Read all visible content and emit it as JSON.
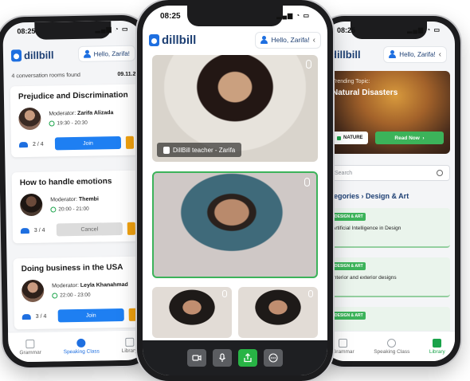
{
  "status": {
    "time": "08:25"
  },
  "brand": {
    "logo_text": "dillbill"
  },
  "header": {
    "greeting": "Hello, Zarifa!"
  },
  "left_phone": {
    "found_text": "4 conversation rooms found",
    "date": "09.11.2",
    "rooms": [
      {
        "title": "Prejudice and Discrimination",
        "moderator_label": "Moderator:",
        "moderator": "Zarifa Alizada",
        "time": "19:30 - 20:30",
        "count": "2 / 4",
        "action": "Join"
      },
      {
        "title": "How to handle emotions",
        "moderator_label": "Moderator:",
        "moderator": "Thembi",
        "time": "20:00 - 21:00",
        "count": "3 / 4",
        "action": "Cancel"
      },
      {
        "title": "Doing business in the USA",
        "moderator_label": "Moderator:",
        "moderator": "Leyla Khanahmad",
        "time": "22:00 - 23:00",
        "count": "3 / 4",
        "action": "Join"
      }
    ],
    "tabs": [
      {
        "label": "Grammar",
        "icon": "book-icon"
      },
      {
        "label": "Speaking Class",
        "icon": "chat-icon"
      },
      {
        "label": "Library",
        "icon": "grid-icon"
      }
    ]
  },
  "center_phone": {
    "teacher_label": "DillBill teacher - Zarifa",
    "controls": [
      "camera-icon",
      "mic-icon",
      "share-icon",
      "more-icon"
    ]
  },
  "right_phone": {
    "hero_kicker": "Trending Topic:",
    "hero_title": "Natural Disasters",
    "chip": "NATURE",
    "read_button": "Read Now",
    "search_placeholder": "Search",
    "breadcrumb": "ategories  ›  Design & Art",
    "topics": [
      {
        "tag": "DESIGN & ART",
        "text": "Artificial Intelligence in Design"
      },
      {
        "tag": "DESIGN & ART",
        "text": "Interior and exterior designs"
      },
      {
        "tag": "DESIGN & ART",
        "text": ""
      }
    ],
    "tabs": [
      {
        "label": "Grammar",
        "icon": "book-icon"
      },
      {
        "label": "Speaking Class",
        "icon": "chat-icon"
      },
      {
        "label": "Library",
        "icon": "grid-icon"
      }
    ]
  },
  "colors": {
    "brand_blue": "#1e6fe0",
    "green": "#28b445",
    "orange": "#f2a20f"
  }
}
